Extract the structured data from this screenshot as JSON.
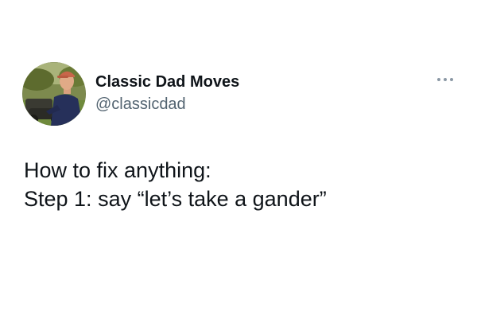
{
  "author": {
    "display_name": "Classic Dad Moves",
    "handle": "@classicdad",
    "avatar_icon": "profile-photo-man-in-cap-on-riding-mower"
  },
  "menu": {
    "icon": "more-dots-icon"
  },
  "tweet": {
    "lines": [
      "How to fix anything:",
      "Step 1: say “let’s take a gander”"
    ]
  },
  "colors": {
    "text_primary": "#0f1419",
    "text_secondary": "#536471",
    "background": "#ffffff"
  }
}
